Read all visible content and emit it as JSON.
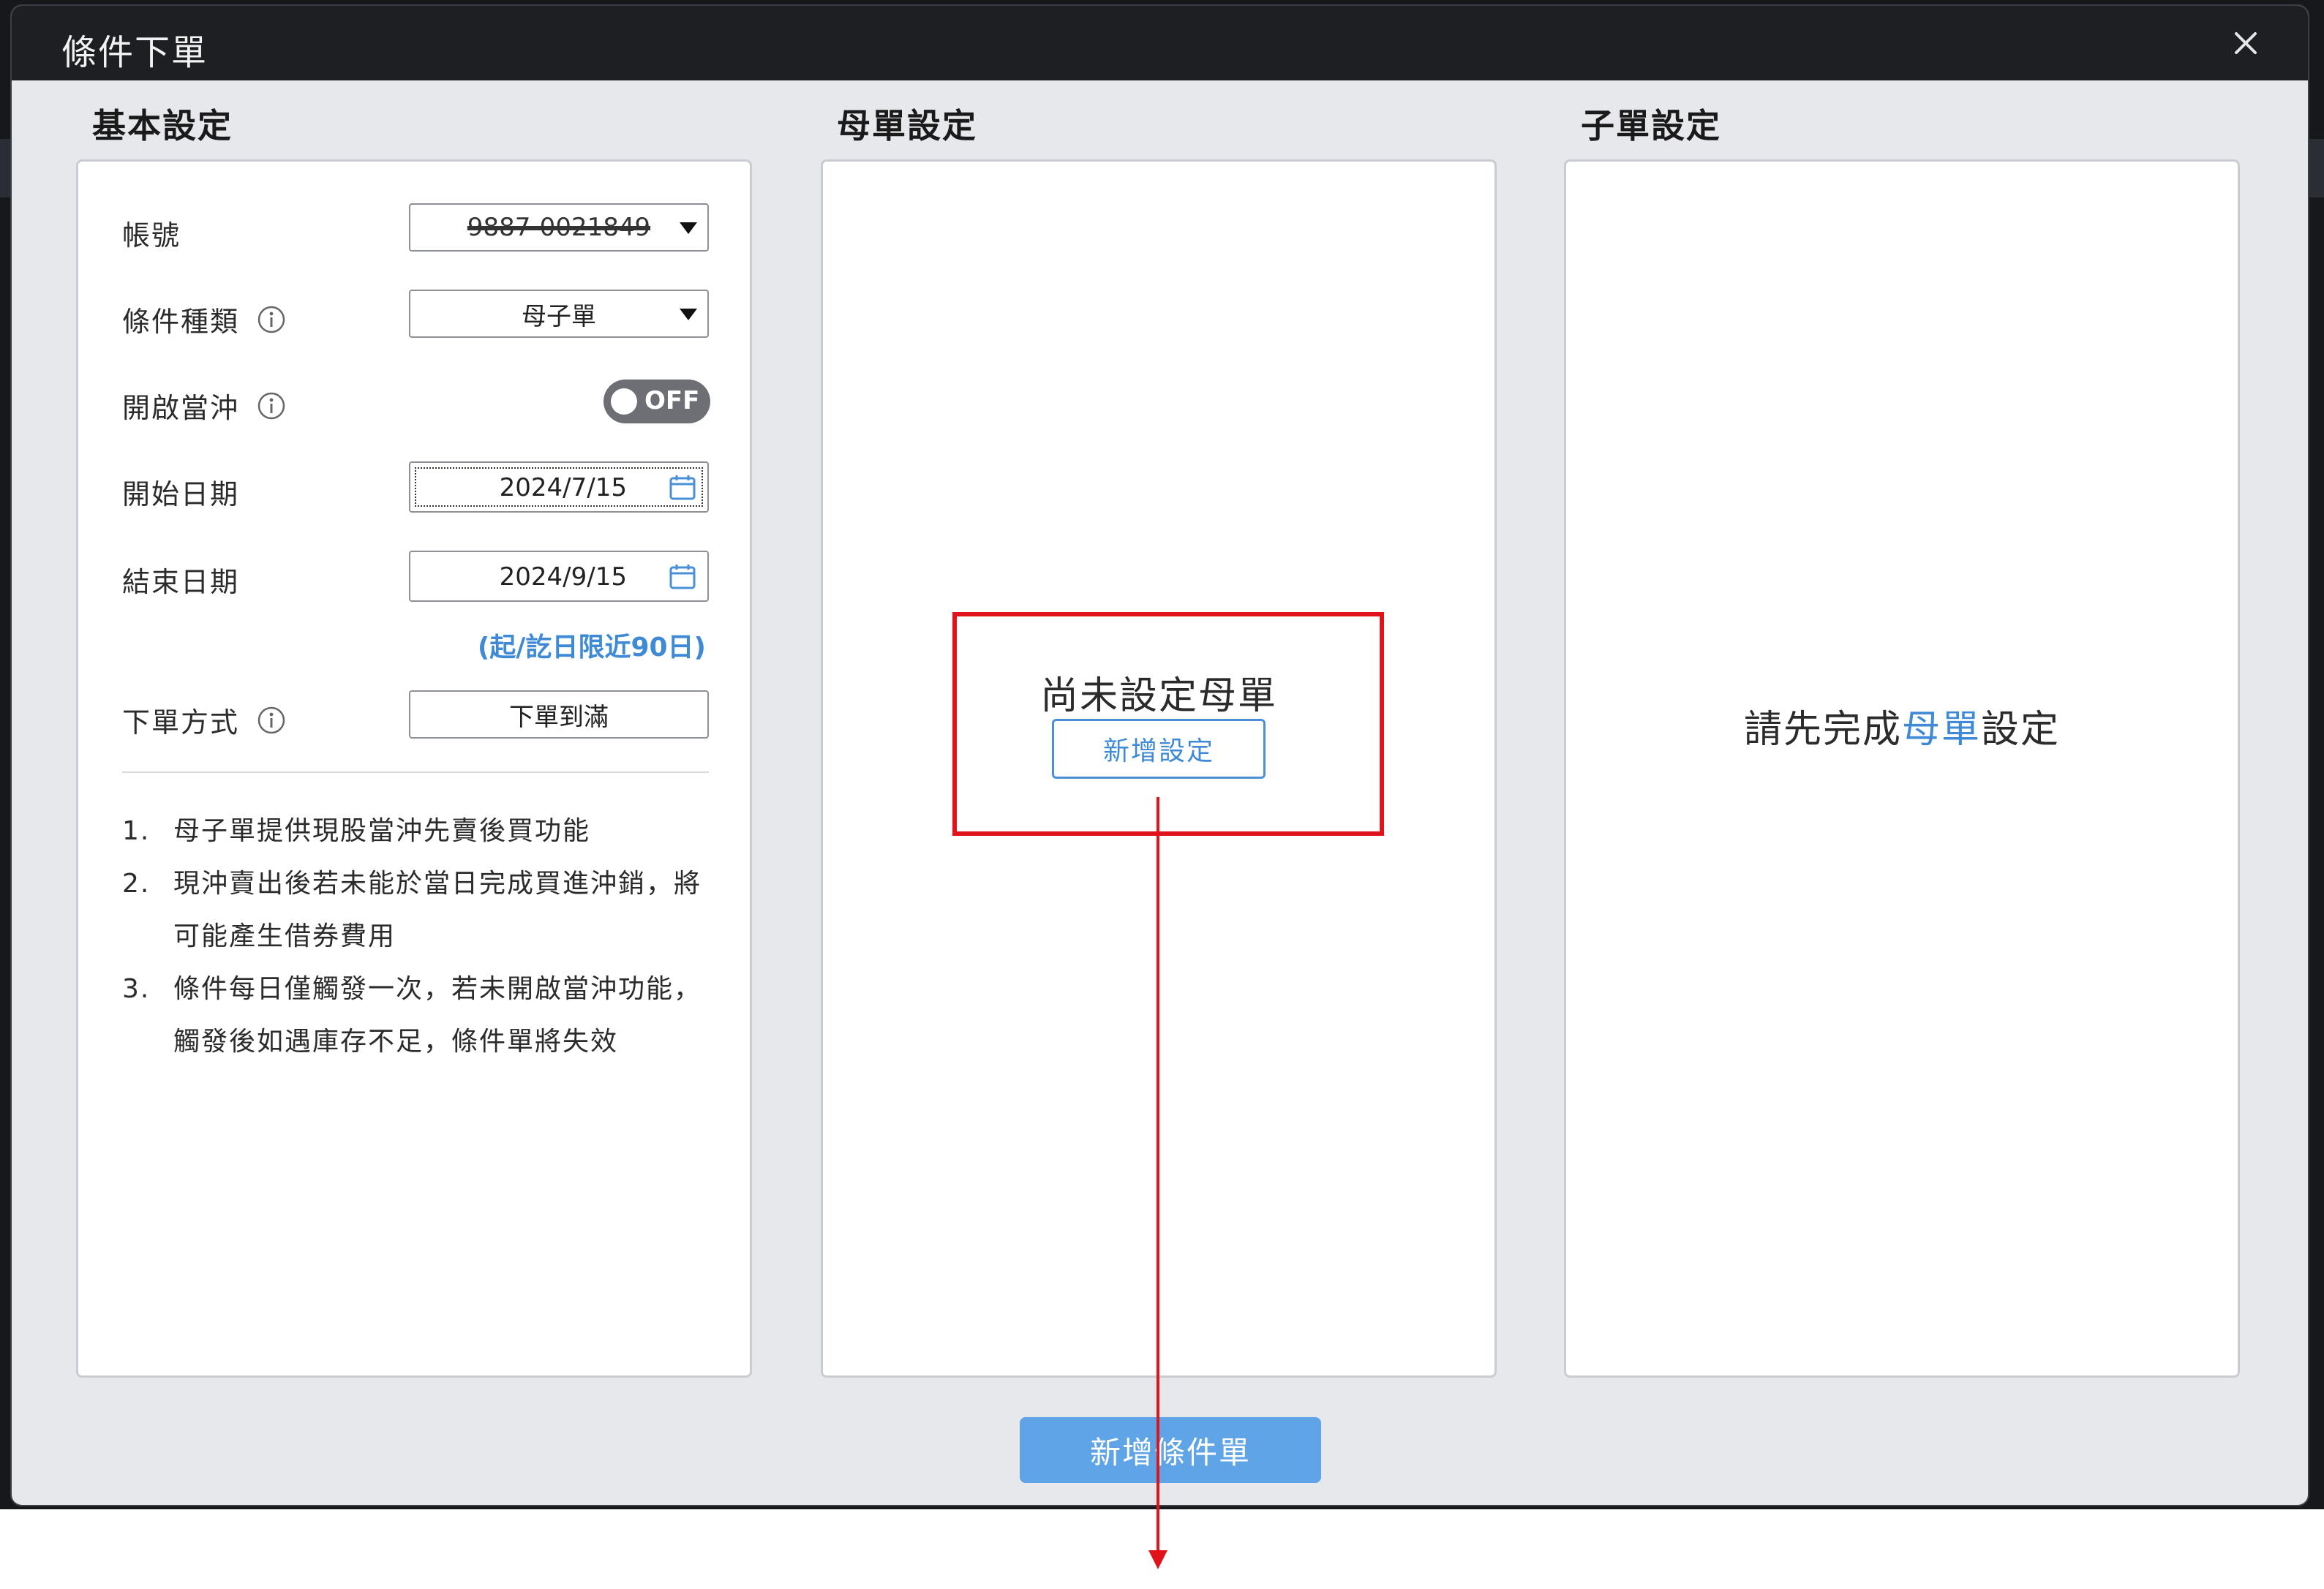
{
  "dialog": {
    "title": "條件下單",
    "close_label": "×"
  },
  "sections": {
    "basic": "基本設定",
    "parent": "母單設定",
    "child": "子單設定"
  },
  "basic": {
    "account_label": "帳號",
    "account_value": "9887-0021849",
    "condition_type_label": "條件種類",
    "condition_type_value": "母子單",
    "day_trade_label": "開啟當沖",
    "day_trade_state": "OFF",
    "start_date_label": "開始日期",
    "start_date_value": "2024/7/15",
    "end_date_label": "結束日期",
    "end_date_value": "2024/9/15",
    "date_range_note": "(起/訖日限近90日)",
    "order_method_label": "下單方式",
    "order_method_value": "下單到滿",
    "notes": [
      {
        "num": "1.",
        "text": "母子單提供現股當沖先賣後買功能"
      },
      {
        "num": "2.",
        "text": "現沖賣出後若未能於當日完成買進沖銷，將可能產生借券費用"
      },
      {
        "num": "3.",
        "text": "條件每日僅觸發一次，若未開啟當沖功能，觸發後如遇庫存不足，條件單將失效"
      }
    ]
  },
  "parent": {
    "empty_message": "尚未設定母單",
    "add_button": "新增設定"
  },
  "child": {
    "message_prefix": "請先完成",
    "message_highlight": "母單",
    "message_suffix": "設定"
  },
  "footer": {
    "add_condition_button": "新增條件單"
  },
  "colors": {
    "accent": "#3e8ad6",
    "primary_button": "#5fa4e6",
    "annotation_red": "#e0131a",
    "toggle_off": "#6d6f74"
  }
}
